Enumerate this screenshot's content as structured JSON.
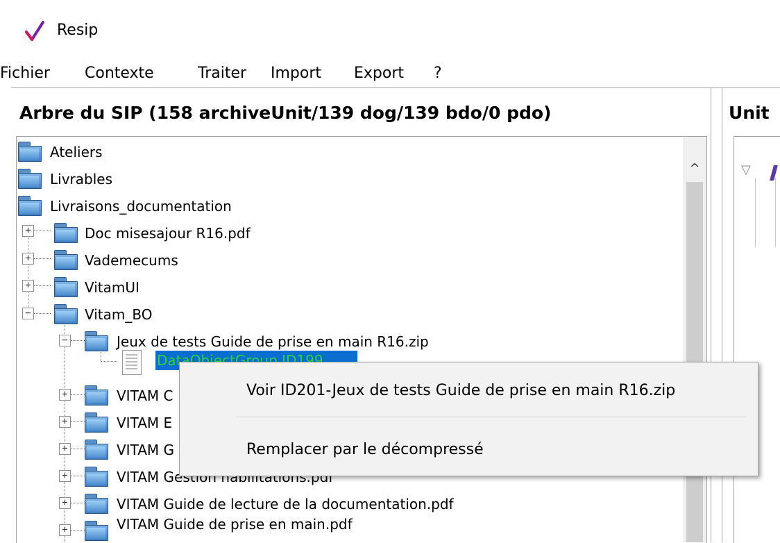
{
  "window": {
    "title": "Resip"
  },
  "menubar": {
    "items": [
      "Fichier",
      "Contexte",
      "Traiter",
      "Import",
      "Export",
      "?"
    ]
  },
  "left_panel": {
    "title": "Arbre du SIP (158 archiveUnit/139 dog/139 bdo/0 pdo)",
    "tree": {
      "ateliers": "Ateliers",
      "livrables": "Livrables",
      "livraisons": "Livraisons_documentation",
      "doc_mises": "Doc misesajour R16.pdf",
      "vademecums": "Vademecums",
      "vitamui": "VitamUI",
      "vitam_bo": "Vitam_BO",
      "jeux": "Jeux de tests Guide de prise en main R16.zip",
      "data_object": "DataObjectGroup ID199",
      "vitam_c": "VITAM C",
      "vitam_e": "VITAM E",
      "vitam_g1": "VITAM G",
      "vitam_gestion": "VITAM Gestion habilitations.pdf",
      "vitam_guide_lecture": "VITAM Guide de lecture de la documentation.pdf",
      "vitam_guide_prise": "VITAM Guide de prise en main.pdf"
    }
  },
  "right_panel": {
    "title": "Unit"
  },
  "context_menu": {
    "voir": "Voir ID201-Jeux de tests Guide de prise en main R16.zip",
    "remplacer": "Remplacer par le décompressé"
  },
  "colors": {
    "selection_bg": "#0a6fd1",
    "selection_text": "#2dd33a",
    "folder": "#4d8dd0"
  }
}
